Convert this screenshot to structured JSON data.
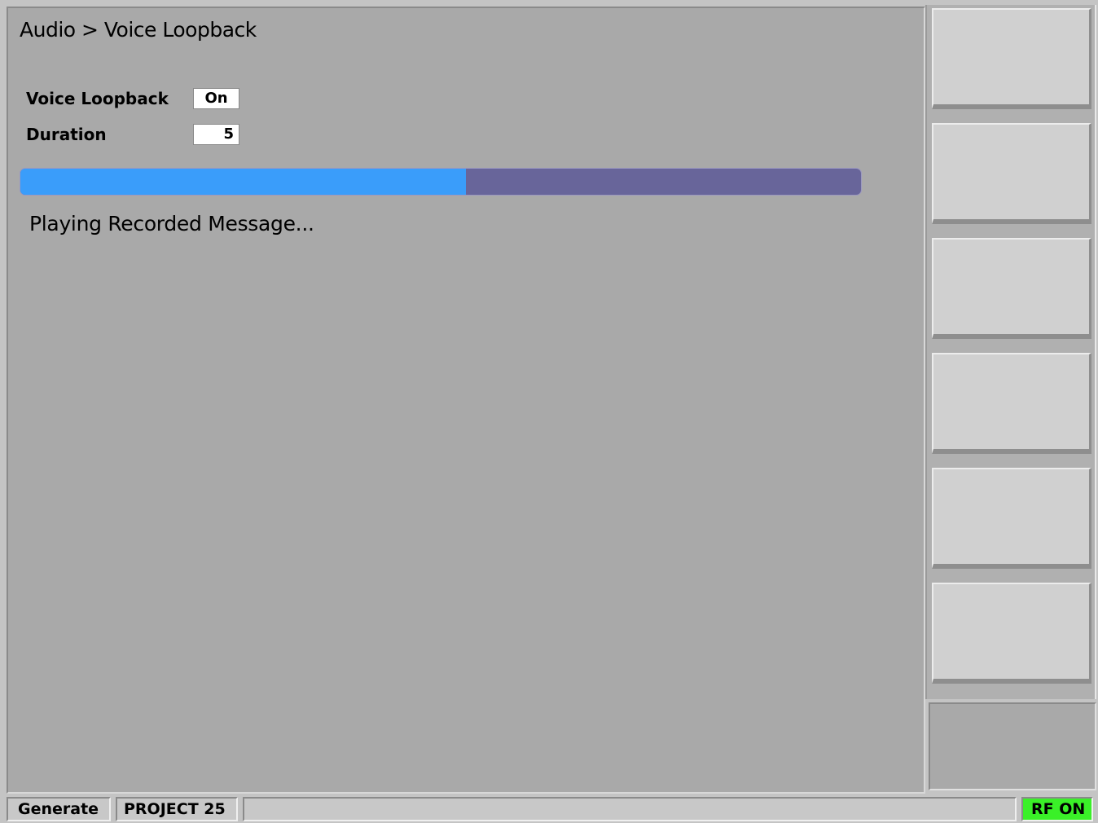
{
  "header": {
    "breadcrumb": "Audio > Voice Loopback"
  },
  "fields": [
    {
      "label": "Voice Loopback",
      "value": "On"
    },
    {
      "label": "Duration",
      "value": "5"
    }
  ],
  "progress": {
    "fraction": 0.53,
    "fill_color": "#3a9dfa",
    "track_color": "#68659a"
  },
  "status_message": "Playing Recorded Message...",
  "softkeys": [
    "",
    "",
    "",
    "",
    "",
    ""
  ],
  "status_bar": {
    "mode": "Generate",
    "system": "PROJECT 25",
    "message": "",
    "rf_state": "RF ON",
    "rf_color": "#3af028"
  }
}
